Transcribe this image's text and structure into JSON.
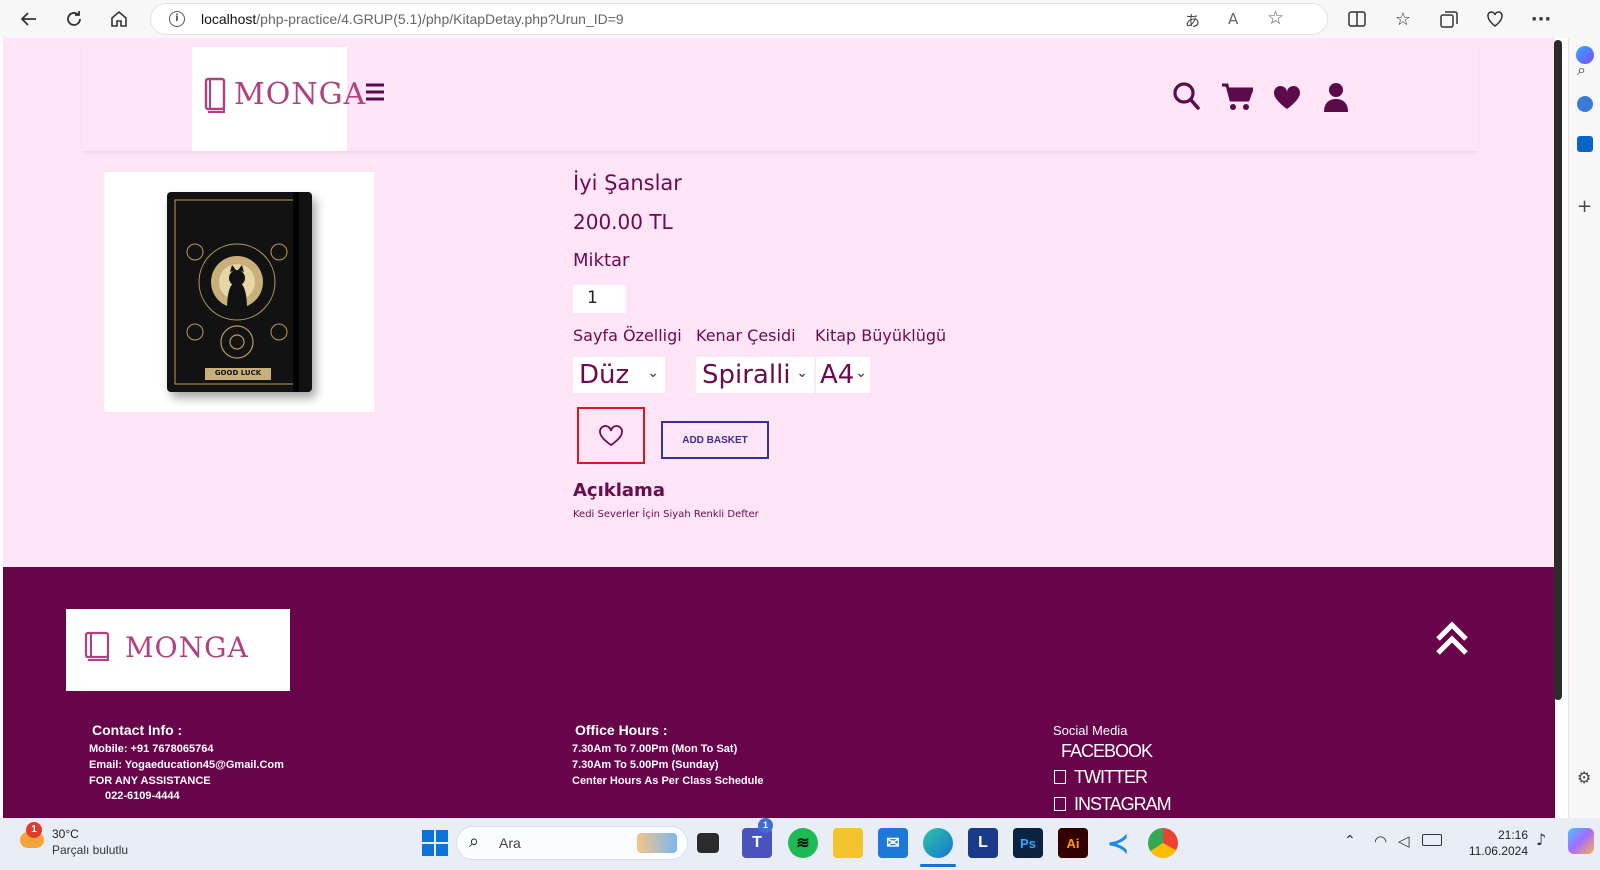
{
  "browser": {
    "url_host": "localhost",
    "url_path": "/php-practice/4.GRUP(5.1)/php/KitapDetay.php?Urun_ID=9"
  },
  "header": {
    "logo_text": "MONGA"
  },
  "product": {
    "name": "İyi Şanslar",
    "price": "200.00 TL",
    "quantity_label": "Miktar",
    "quantity_value": "1",
    "option_labels": [
      "Sayfa Özelligi",
      "Kenar Çesidi",
      "Kitap Büyüklügü"
    ],
    "page_option": "Düz",
    "edge_option": "Spiralli",
    "size_option": "A4",
    "add_basket_label": "ADD BASKET",
    "description_title": "Açıklama",
    "description_text": "Kedi Severler İçin Siyah Renkli Defter",
    "cover_text": "GOOD LUCK"
  },
  "footer": {
    "logo_text": "MONGA",
    "contact_title": "Contact Info :",
    "contact_lines": [
      "Mobile: +91 7678065764",
      "Email: Yogaeducation45@Gmail.Com",
      "FOR ANY ASSISTANCE",
      "022-6109-4444"
    ],
    "office_title": "Office Hours :",
    "office_lines": [
      "7.30Am To 7.00Pm (Mon To Sat)",
      "7.30Am To 5.00Pm (Sunday)",
      "Center Hours As Per Class Schedule"
    ],
    "social_title": "Social Media",
    "social_links": [
      "FACEBOOK",
      "TWITTER",
      "INSTAGRAM"
    ]
  },
  "taskbar": {
    "weather_temp": "30°C",
    "weather_desc": "Parçalı bulutlu",
    "weather_badge": "1",
    "search_placeholder": "Ara",
    "teams_badge": "1",
    "time": "21:16",
    "date": "11.06.2024"
  },
  "colors": {
    "page_bg": "#fde4f6",
    "accent": "#6b0b4f",
    "footer_bg": "#680449",
    "logo": "#b1407f",
    "fav_border": "#e0161a",
    "basket_border": "#3b2f8f"
  }
}
